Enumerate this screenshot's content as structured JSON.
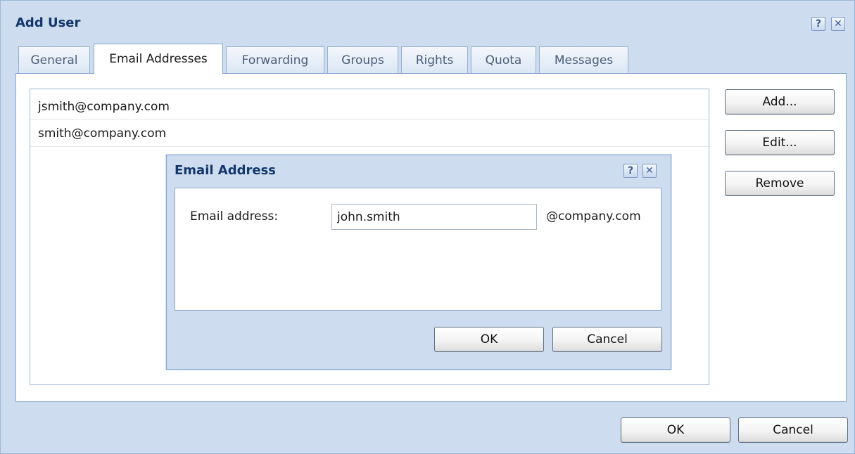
{
  "dialog": {
    "title": "Add User",
    "help_label": "?",
    "close_label": "✕"
  },
  "tabs": [
    {
      "label": "General"
    },
    {
      "label": "Email Addresses",
      "active": true
    },
    {
      "label": "Forwarding"
    },
    {
      "label": "Groups"
    },
    {
      "label": "Rights"
    },
    {
      "label": "Quota"
    },
    {
      "label": "Messages"
    }
  ],
  "email_list": [
    "jsmith@company.com",
    "smith@company.com"
  ],
  "side_buttons": {
    "add": "Add...",
    "edit": "Edit...",
    "remove": "Remove"
  },
  "email_dialog": {
    "title": "Email Address",
    "help_label": "?",
    "close_label": "✕",
    "field_label": "Email address:",
    "field_value": "john.smith",
    "domain": "@company.com",
    "ok": "OK",
    "cancel": "Cancel"
  },
  "footer": {
    "ok": "OK",
    "cancel": "Cancel"
  },
  "colors": {
    "dialog_bg": "#cddcee",
    "title": "#13366b",
    "border": "#8aa6cc"
  }
}
